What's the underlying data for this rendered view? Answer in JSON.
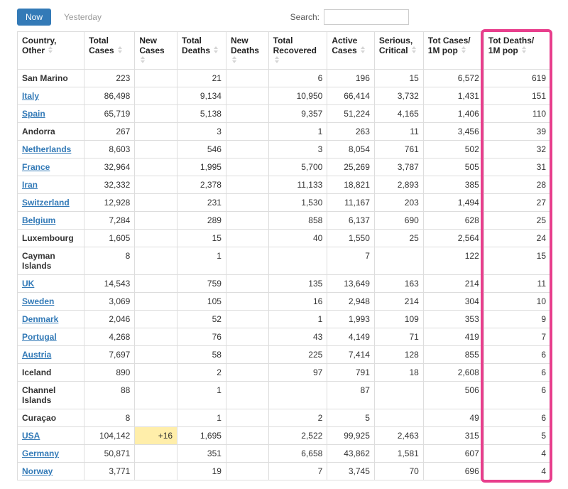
{
  "tabs": {
    "now": "Now",
    "yesterday": "Yesterday"
  },
  "search": {
    "label": "Search:",
    "value": ""
  },
  "columns": [
    "Country, Other",
    "Total Cases",
    "New Cases",
    "Total Deaths",
    "New Deaths",
    "Total Recovered",
    "Active Cases",
    "Serious, Critical",
    "Tot Cases/ 1M pop",
    "Tot Deaths/ 1M pop"
  ],
  "rows": [
    {
      "country": "San Marino",
      "link": false,
      "total": "223",
      "new": "",
      "deaths": "21",
      "newd": "",
      "rec": "6",
      "active": "196",
      "crit": "15",
      "cpm": "6,572",
      "dpm": "619"
    },
    {
      "country": "Italy",
      "link": true,
      "total": "86,498",
      "new": "",
      "deaths": "9,134",
      "newd": "",
      "rec": "10,950",
      "active": "66,414",
      "crit": "3,732",
      "cpm": "1,431",
      "dpm": "151"
    },
    {
      "country": "Spain",
      "link": true,
      "total": "65,719",
      "new": "",
      "deaths": "5,138",
      "newd": "",
      "rec": "9,357",
      "active": "51,224",
      "crit": "4,165",
      "cpm": "1,406",
      "dpm": "110"
    },
    {
      "country": "Andorra",
      "link": false,
      "total": "267",
      "new": "",
      "deaths": "3",
      "newd": "",
      "rec": "1",
      "active": "263",
      "crit": "11",
      "cpm": "3,456",
      "dpm": "39"
    },
    {
      "country": "Netherlands",
      "link": true,
      "total": "8,603",
      "new": "",
      "deaths": "546",
      "newd": "",
      "rec": "3",
      "active": "8,054",
      "crit": "761",
      "cpm": "502",
      "dpm": "32"
    },
    {
      "country": "France",
      "link": true,
      "total": "32,964",
      "new": "",
      "deaths": "1,995",
      "newd": "",
      "rec": "5,700",
      "active": "25,269",
      "crit": "3,787",
      "cpm": "505",
      "dpm": "31"
    },
    {
      "country": "Iran",
      "link": true,
      "total": "32,332",
      "new": "",
      "deaths": "2,378",
      "newd": "",
      "rec": "11,133",
      "active": "18,821",
      "crit": "2,893",
      "cpm": "385",
      "dpm": "28"
    },
    {
      "country": "Switzerland",
      "link": true,
      "total": "12,928",
      "new": "",
      "deaths": "231",
      "newd": "",
      "rec": "1,530",
      "active": "11,167",
      "crit": "203",
      "cpm": "1,494",
      "dpm": "27"
    },
    {
      "country": "Belgium",
      "link": true,
      "total": "7,284",
      "new": "",
      "deaths": "289",
      "newd": "",
      "rec": "858",
      "active": "6,137",
      "crit": "690",
      "cpm": "628",
      "dpm": "25"
    },
    {
      "country": "Luxembourg",
      "link": false,
      "total": "1,605",
      "new": "",
      "deaths": "15",
      "newd": "",
      "rec": "40",
      "active": "1,550",
      "crit": "25",
      "cpm": "2,564",
      "dpm": "24"
    },
    {
      "country": "Cayman Islands",
      "link": false,
      "total": "8",
      "new": "",
      "deaths": "1",
      "newd": "",
      "rec": "",
      "active": "7",
      "crit": "",
      "cpm": "122",
      "dpm": "15"
    },
    {
      "country": "UK",
      "link": true,
      "total": "14,543",
      "new": "",
      "deaths": "759",
      "newd": "",
      "rec": "135",
      "active": "13,649",
      "crit": "163",
      "cpm": "214",
      "dpm": "11"
    },
    {
      "country": "Sweden",
      "link": true,
      "total": "3,069",
      "new": "",
      "deaths": "105",
      "newd": "",
      "rec": "16",
      "active": "2,948",
      "crit": "214",
      "cpm": "304",
      "dpm": "10"
    },
    {
      "country": "Denmark",
      "link": true,
      "total": "2,046",
      "new": "",
      "deaths": "52",
      "newd": "",
      "rec": "1",
      "active": "1,993",
      "crit": "109",
      "cpm": "353",
      "dpm": "9"
    },
    {
      "country": "Portugal",
      "link": true,
      "total": "4,268",
      "new": "",
      "deaths": "76",
      "newd": "",
      "rec": "43",
      "active": "4,149",
      "crit": "71",
      "cpm": "419",
      "dpm": "7"
    },
    {
      "country": "Austria",
      "link": true,
      "total": "7,697",
      "new": "",
      "deaths": "58",
      "newd": "",
      "rec": "225",
      "active": "7,414",
      "crit": "128",
      "cpm": "855",
      "dpm": "6"
    },
    {
      "country": "Iceland",
      "link": false,
      "total": "890",
      "new": "",
      "deaths": "2",
      "newd": "",
      "rec": "97",
      "active": "791",
      "crit": "18",
      "cpm": "2,608",
      "dpm": "6"
    },
    {
      "country": "Channel Islands",
      "link": false,
      "total": "88",
      "new": "",
      "deaths": "1",
      "newd": "",
      "rec": "",
      "active": "87",
      "crit": "",
      "cpm": "506",
      "dpm": "6"
    },
    {
      "country": "Curaçao",
      "link": false,
      "total": "8",
      "new": "",
      "deaths": "1",
      "newd": "",
      "rec": "2",
      "active": "5",
      "crit": "",
      "cpm": "49",
      "dpm": "6"
    },
    {
      "country": "USA",
      "link": true,
      "total": "104,142",
      "new": "+16",
      "newhl": true,
      "deaths": "1,695",
      "newd": "",
      "rec": "2,522",
      "active": "99,925",
      "crit": "2,463",
      "cpm": "315",
      "dpm": "5"
    },
    {
      "country": "Germany",
      "link": true,
      "total": "50,871",
      "new": "",
      "deaths": "351",
      "newd": "",
      "rec": "6,658",
      "active": "43,862",
      "crit": "1,581",
      "cpm": "607",
      "dpm": "4"
    },
    {
      "country": "Norway",
      "link": true,
      "total": "3,771",
      "new": "",
      "deaths": "19",
      "newd": "",
      "rec": "7",
      "active": "3,745",
      "crit": "70",
      "cpm": "696",
      "dpm": "4"
    }
  ],
  "chart_data": {
    "type": "table",
    "title": "COVID-19 cases by country sorted by Tot Deaths/1M pop",
    "columns": [
      "Country, Other",
      "Total Cases",
      "New Cases",
      "Total Deaths",
      "New Deaths",
      "Total Recovered",
      "Active Cases",
      "Serious, Critical",
      "Tot Cases/ 1M pop",
      "Tot Deaths/ 1M pop"
    ],
    "highlight_column": "Tot Deaths/ 1M pop"
  }
}
